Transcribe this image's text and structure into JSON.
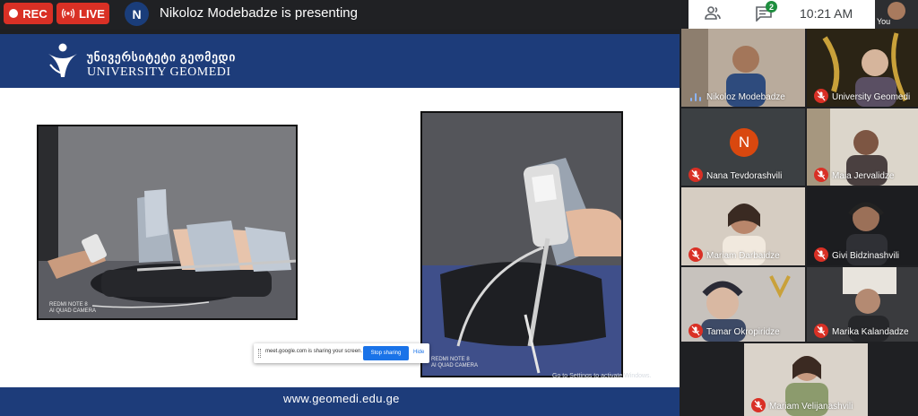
{
  "top_bar": {
    "rec_label": "REC",
    "live_label": "LIVE",
    "presenter_initial": "N",
    "presenting_text": "Nikoloz Modebadze is presenting"
  },
  "right_bar": {
    "people_icon": "people-icon",
    "chat_icon": "chat-icon",
    "chat_badge": "2",
    "time": "10:21 AM",
    "self_label": "You"
  },
  "slide": {
    "logo_georgian": "უნივერსიტეტი გეომედი",
    "logo_english": "UNIVERSITY GEOMEDI",
    "photo1_camera_mark": "REDMI NOTE 8\nAI QUAD CAMERA",
    "photo2_camera_mark": "REDMI NOTE 8\nAI QUAD CAMERA",
    "footer_url": "www.geomedi.edu.ge",
    "activate_windows": "Go to Settings to activate Windows."
  },
  "share_bar": {
    "text": "meet.google.com is sharing your screen.",
    "stop_label": "Stop sharing",
    "hide_label": "Hide"
  },
  "participants": [
    {
      "name": "Nikoloz Modebadze",
      "state": "speaking"
    },
    {
      "name": "University Geomedi",
      "state": "muted"
    },
    {
      "name": "Nana Tevdorashvili",
      "state": "muted",
      "initial": "N"
    },
    {
      "name": "Maia Jervalidze",
      "state": "muted"
    },
    {
      "name": "Mariam Darbaidze",
      "state": "muted"
    },
    {
      "name": "Givi Bidzinashvili",
      "state": "muted"
    },
    {
      "name": "Tamar Okropiridze",
      "state": "muted"
    },
    {
      "name": "Marika Kalandadze",
      "state": "muted"
    },
    {
      "name": "Mariam Velijanashvili",
      "state": "muted"
    }
  ],
  "colors": {
    "rec_red": "#d93025",
    "slide_blue": "#1d3c7a",
    "share_blue": "#1a73e8",
    "badge_green": "#1e8e3e",
    "avatar_orange": "#d9480f"
  }
}
